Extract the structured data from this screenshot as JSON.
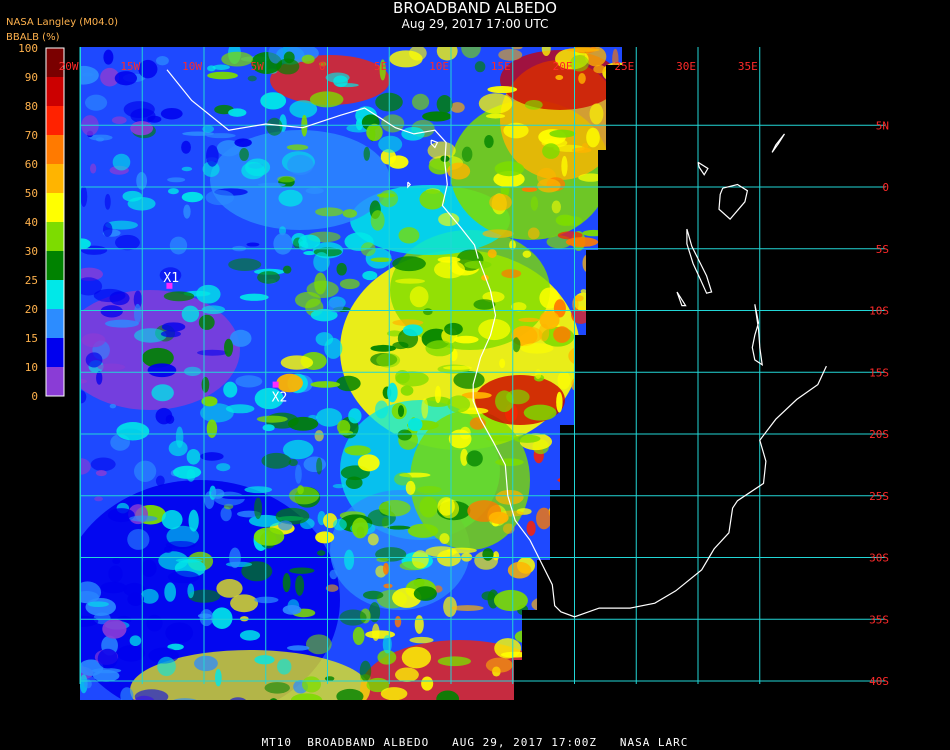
{
  "header": {
    "title": "BROADBAND ALBEDO",
    "subtitle": "Aug 29, 2017 17:00 UTC",
    "producer": "NASA Langley (M04.0)",
    "unit_label": "BBALB (%)"
  },
  "colorbar": {
    "ticks": [
      "100",
      "90",
      "80",
      "70",
      "60",
      "50",
      "40",
      "30",
      "25",
      "20",
      "15",
      "10",
      "0"
    ],
    "bands": [
      {
        "range": "90-100",
        "color": "#7a0000"
      },
      {
        "range": "80-90",
        "color": "#cc0000"
      },
      {
        "range": "70-80",
        "color": "#ff2200"
      },
      {
        "range": "60-70",
        "color": "#ff7a00"
      },
      {
        "range": "50-60",
        "color": "#ffb400"
      },
      {
        "range": "40-50",
        "color": "#ffff00"
      },
      {
        "range": "30-40",
        "color": "#7ddc00"
      },
      {
        "range": "25-30",
        "color": "#008200"
      },
      {
        "range": "20-25",
        "color": "#00e8e8"
      },
      {
        "range": "15-20",
        "color": "#2c8cff"
      },
      {
        "range": "10-15",
        "color": "#0000ee"
      },
      {
        "range": "0-10",
        "color": "#8a3cd6"
      }
    ]
  },
  "map": {
    "lon_labels": [
      "20W",
      "15W",
      "10W",
      "5W",
      "0",
      "5E",
      "10E",
      "15E",
      "20E",
      "25E",
      "30E",
      "35E"
    ],
    "lat_labels": [
      "5N",
      "0",
      "5S",
      "10S",
      "15S",
      "20S",
      "25S",
      "30S",
      "35S",
      "40S"
    ],
    "markers": [
      {
        "label": "X1",
        "lon": -12.8,
        "lat": -8.0
      },
      {
        "label": "X2",
        "lon": -4.2,
        "lat": -16.0
      }
    ],
    "grid_color": "#22d6d6",
    "label_color": "#ff2a2a",
    "coast_color": "#ffffff",
    "marker_color": "#ff2aff"
  },
  "footer": {
    "text": "MT10  BROADBAND ALBEDO   AUG 29, 2017 17:00Z   NASA LARC"
  }
}
